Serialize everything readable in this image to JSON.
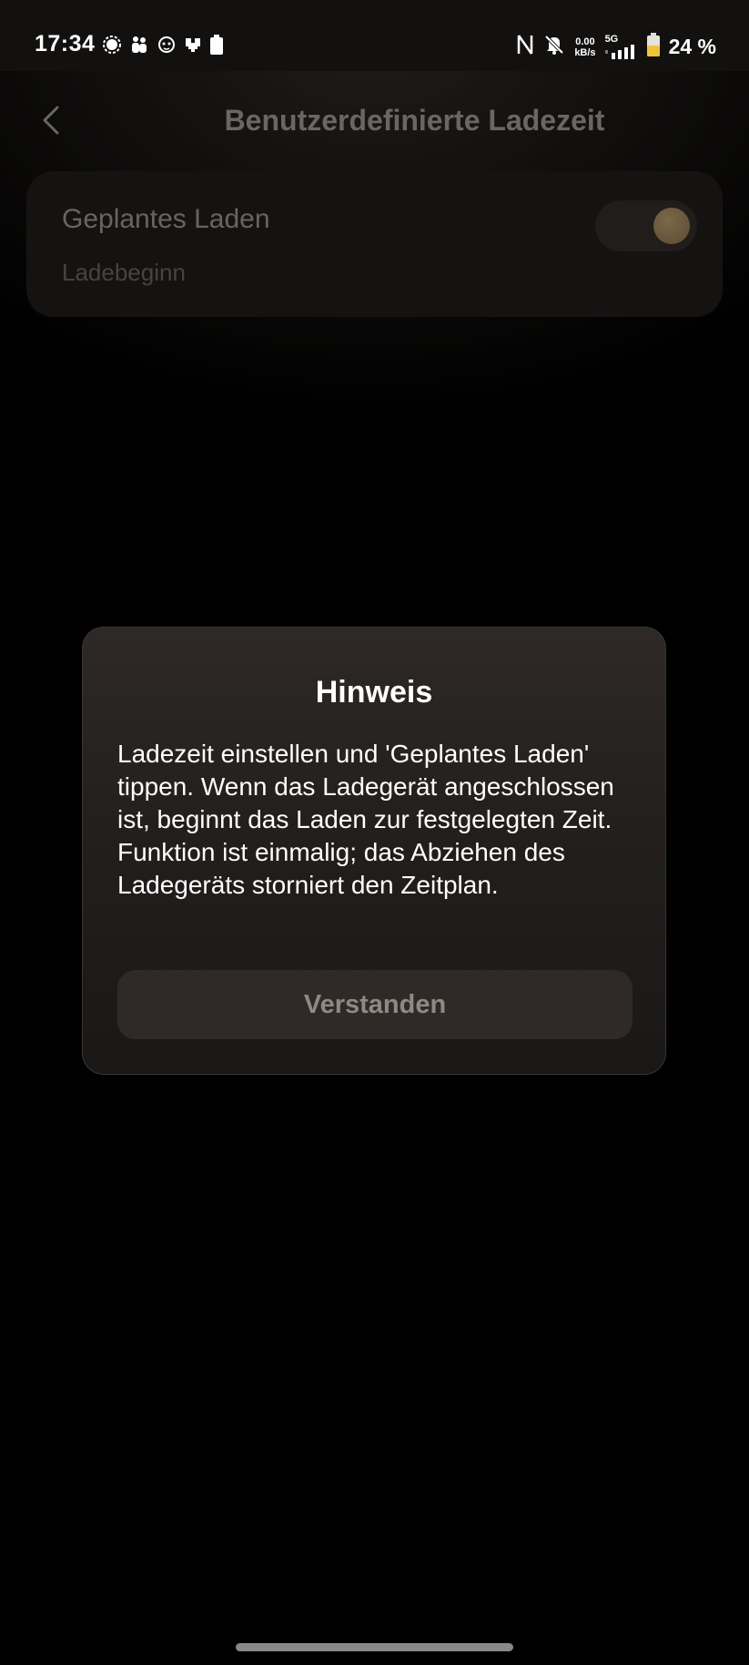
{
  "status_bar": {
    "time": "17:34",
    "left_icons": [
      "signal-messenger-icon",
      "people-icon",
      "lion-app-icon",
      "pixel-heart-icon",
      "battery-small-icon"
    ],
    "net_speed_value": "0.00",
    "net_speed_unit": "kB/s",
    "network_type": "5G",
    "battery_percent": "24 %"
  },
  "header": {
    "title": "Benutzerdefinierte Ladezeit",
    "back_icon": "chevron-left-icon"
  },
  "card": {
    "title": "Geplantes Laden",
    "subtitle": "Ladebeginn",
    "toggle_state": "on"
  },
  "dialog": {
    "title": "Hinweis",
    "message": "Ladezeit einstellen und 'Geplantes Laden' tippen. Wenn das Ladegerät angeschlossen ist, beginnt das Laden zur festgelegten Zeit. Funktion ist einmalig; das Abziehen des Ladegeräts storniert den Zeitplan.",
    "button_label": "Verstanden"
  },
  "colors": {
    "background": "#000000",
    "card": "#1c1a18",
    "toggle_knob": "#9a8058",
    "dialog": "#2a2623",
    "button": "#2f2a27"
  }
}
